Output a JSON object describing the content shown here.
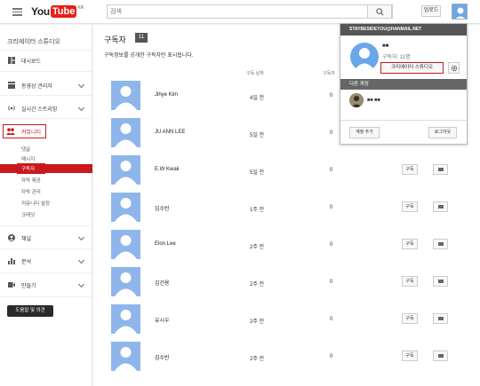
{
  "header": {
    "logo_you": "You",
    "logo_tube": "Tube",
    "logo_region": "KR",
    "search_placeholder": "검색",
    "upload_label": "업로드"
  },
  "sidebar": {
    "title": "크리에이터 스튜디오",
    "items": [
      {
        "label": "대시보드",
        "icon": "dashboard-icon"
      },
      {
        "label": "동영상 관리자",
        "icon": "video-manager-icon"
      },
      {
        "label": "실시간 스트리밍",
        "icon": "live-icon"
      },
      {
        "label": "커뮤니티",
        "icon": "community-icon"
      }
    ],
    "community_sub": [
      "댓글",
      "메시지",
      "구독자",
      "자막 제공",
      "자막 관리",
      "커뮤니티 설정",
      "크레딧"
    ],
    "lower_items": [
      {
        "label": "채널",
        "icon": "channel-icon"
      },
      {
        "label": "분석",
        "icon": "analytics-icon"
      },
      {
        "label": "만들기",
        "icon": "create-icon"
      }
    ],
    "help_label": "도움말 및 의견"
  },
  "main": {
    "title": "구독자",
    "count": "11",
    "description": "구독정보를 공개한 구독자만 표시됩니다.",
    "col_date": "구독 날짜",
    "col_subs": "구독자",
    "subscribe_label": "구독",
    "rows": [
      {
        "name": "Jihye Kim",
        "date": "4일 전",
        "subs": "0"
      },
      {
        "name": "JU ANN LEE",
        "date": "5일 전",
        "subs": "0"
      },
      {
        "name": "E.W Kwak",
        "date": "5일 전",
        "subs": "0"
      },
      {
        "name": "임수빈",
        "date": "1주 전",
        "subs": "0"
      },
      {
        "name": "Elon Lee",
        "date": "2주 전",
        "subs": "0"
      },
      {
        "name": "김건용",
        "date": "2주 전",
        "subs": "0"
      },
      {
        "name": "유시우",
        "date": "2주 전",
        "subs": "0"
      },
      {
        "name": "김수빈",
        "date": "2주 전",
        "subs": "0"
      }
    ]
  },
  "popup": {
    "email": "STAYBESIDEYOU@HANMAIL.NET",
    "name": "■■",
    "subs": "구독자: 11명",
    "studio_label": "크리에이터 스튜디오",
    "other_accounts": "다른 계정",
    "other_name": "■■ ■■",
    "add_account": "계정 추가",
    "logout": "로그아웃"
  },
  "colors": {
    "accent": "#c9191f",
    "avatar": "#8fb6ea",
    "popup_header": "#555555"
  }
}
